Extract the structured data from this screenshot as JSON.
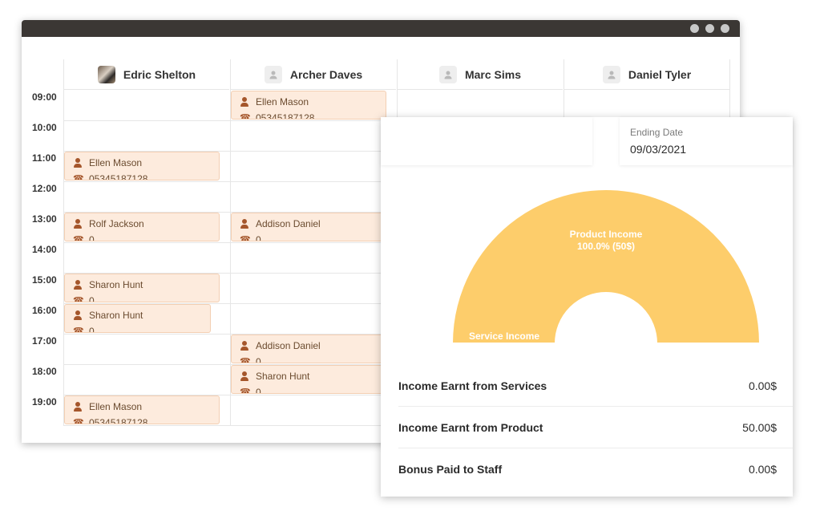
{
  "staff": [
    {
      "name": "Edric Shelton",
      "avatar": "photo"
    },
    {
      "name": "Archer Daves",
      "avatar": "placeholder"
    },
    {
      "name": "Marc Sims",
      "avatar": "placeholder"
    },
    {
      "name": "Daniel Tyler",
      "avatar": "placeholder"
    }
  ],
  "times": [
    "09:00",
    "10:00",
    "11:00",
    "12:00",
    "13:00",
    "14:00",
    "15:00",
    "16:00",
    "17:00",
    "18:00",
    "19:00"
  ],
  "appointments": [
    {
      "staff": 1,
      "slot": 0,
      "name": "Ellen Mason",
      "phone": "05345187128"
    },
    {
      "staff": 0,
      "slot": 2,
      "name": "Ellen Mason",
      "phone": "05345187128"
    },
    {
      "staff": 0,
      "slot": 4,
      "name": "Rolf Jackson",
      "phone": "0"
    },
    {
      "staff": 1,
      "slot": 4,
      "name": "Addison Daniel",
      "phone": "0"
    },
    {
      "staff": 0,
      "slot": 6,
      "name": "Sharon Hunt",
      "phone": "0"
    },
    {
      "staff": 0,
      "slot": 7,
      "name": "Sharon Hunt",
      "phone": "0"
    },
    {
      "staff": 1,
      "slot": 8,
      "name": "Addison Daniel",
      "phone": "0"
    },
    {
      "staff": 1,
      "slot": 9,
      "name": "Sharon Hunt",
      "phone": "0"
    },
    {
      "staff": 0,
      "slot": 10,
      "name": "Ellen Mason",
      "phone": "05345187128"
    }
  ],
  "report": {
    "ending_date_label": "Ending Date",
    "ending_date_value": "09/03/2021",
    "summary": [
      {
        "label": "Income Earnt from Services",
        "value": "0.00$"
      },
      {
        "label": "Income Earnt from Product",
        "value": "50.00$"
      },
      {
        "label": "Bonus Paid to Staff",
        "value": "0.00$"
      }
    ]
  },
  "chart_data": {
    "type": "pie",
    "variant": "half-donut",
    "slices": [
      {
        "label": "Product Income",
        "value": 50,
        "percent_label": "100.0% (50$)",
        "color": "#fdcd6b"
      },
      {
        "label": "Service Income",
        "value": 0,
        "color": "#fdcd6b"
      }
    ]
  },
  "colors": {
    "titlebar": "#3b3734",
    "appointment_bg": "#fdebdd",
    "appointment_icon": "#a5562b",
    "chart_fill": "#fdcd6b"
  }
}
